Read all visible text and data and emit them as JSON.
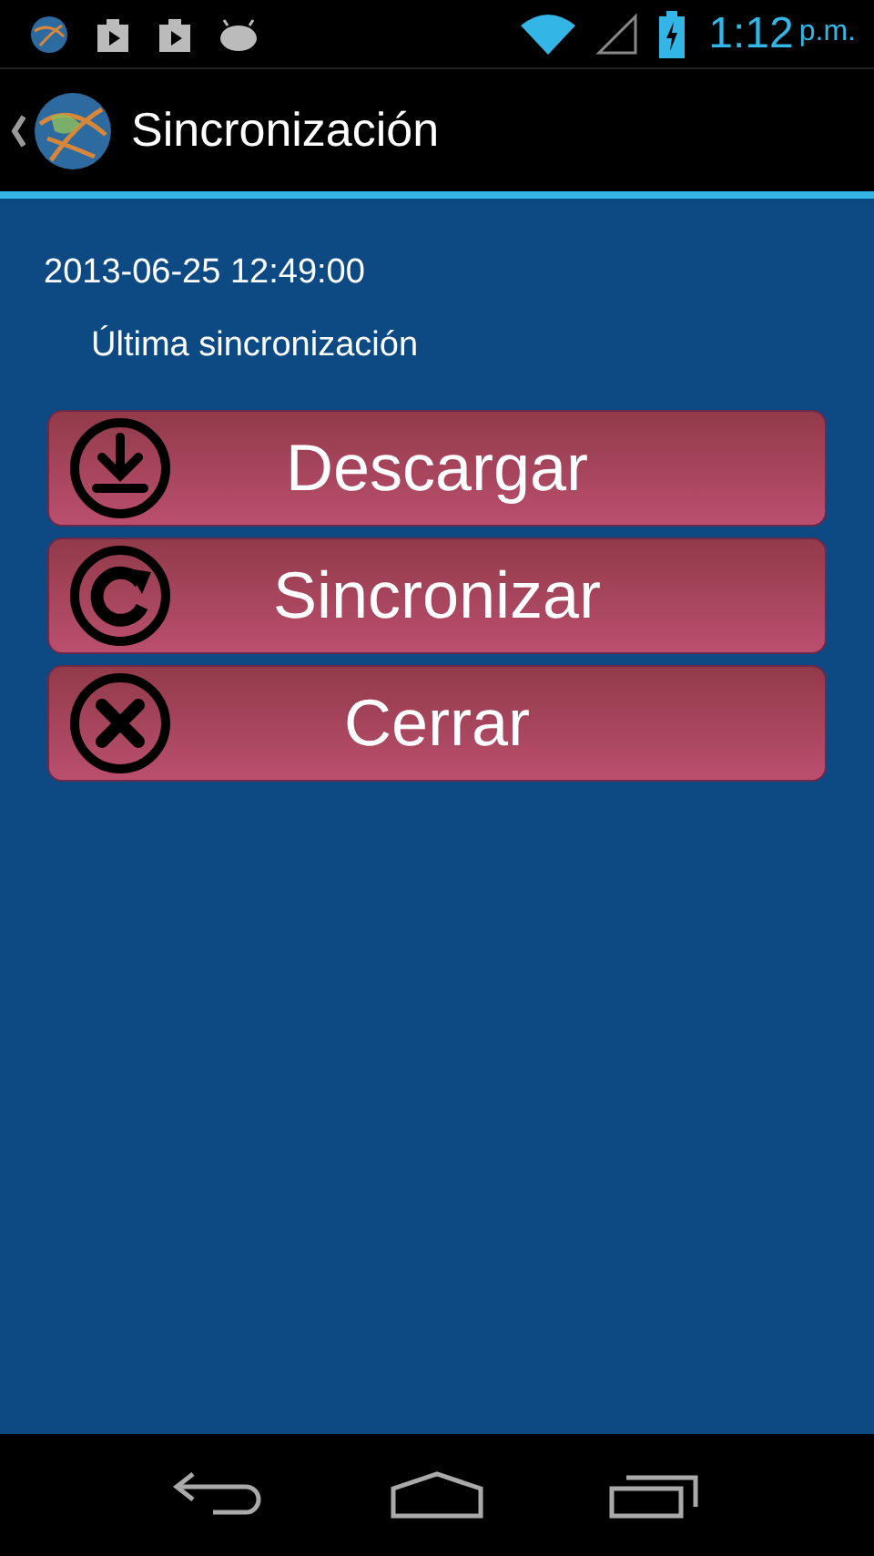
{
  "status_bar": {
    "time": "1:12",
    "meridiem": "p.m."
  },
  "action_bar": {
    "title": "Sincronización"
  },
  "last_sync": {
    "value": "2013-06-25 12:49:00",
    "label": "Última sincronización"
  },
  "buttons": [
    {
      "label": "Descargar",
      "kind": "download"
    },
    {
      "label": "Sincronizar",
      "kind": "sync"
    },
    {
      "label": "Cerrar",
      "kind": "close"
    }
  ]
}
